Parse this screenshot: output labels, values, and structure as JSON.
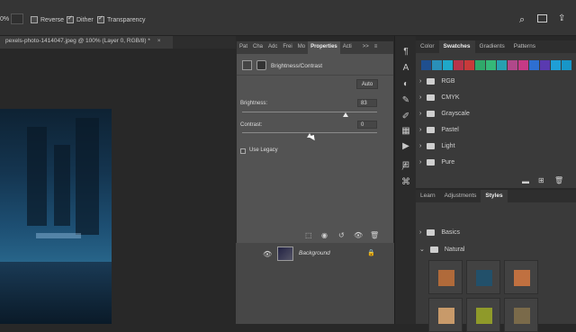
{
  "options_bar": {
    "zoom_value": "0%",
    "reverse_label": "Reverse",
    "reverse_checked": false,
    "dither_label": "Dither",
    "dither_checked": true,
    "transparency_label": "Transparency",
    "transparency_checked": true
  },
  "document": {
    "tab_title": "pexels-photo-1414047.jpeg @ 100% (Layer 0, RGB/8) *",
    "close_glyph": "×"
  },
  "properties_panel": {
    "tabs": [
      "Pat",
      "Cha",
      "Adc",
      "Frei",
      "Mo",
      "Properties",
      "Acti"
    ],
    "active_tab": "Properties",
    "collapse_glyph": ">>",
    "menu_glyph": "≡",
    "adjustment_title": "Brightness/Contrast",
    "auto_button": "Auto",
    "brightness_label": "Brightness:",
    "brightness_value": "83",
    "contrast_label": "Contrast:",
    "contrast_value": "0",
    "use_legacy_label": "Use Legacy",
    "use_legacy_checked": false
  },
  "layers": {
    "background_layer_name": "Background"
  },
  "swatches_panel": {
    "tabs": [
      "Color",
      "Swatches",
      "Gradients",
      "Patterns"
    ],
    "active_tab": "Swatches",
    "swatch_colors": [
      "#1f4f8f",
      "#2a8fb8",
      "#1fa8c8",
      "#b8344a",
      "#c93a3a",
      "#2fa86a",
      "#35b878",
      "#27a0b0",
      "#b0488a",
      "#c53a86",
      "#2e6fd1",
      "#5a3ab0",
      "#1f9fd6",
      "#1896c8"
    ],
    "folders": [
      "RGB",
      "CMYK",
      "Grayscale",
      "Pastel",
      "Light",
      "Pure"
    ]
  },
  "styles_panel": {
    "tabs": [
      "Learn",
      "Adjustments",
      "Styles"
    ],
    "active_tab": "Styles",
    "folders": [
      "Basics",
      "Natural"
    ],
    "tile_colors": [
      "#b06a3a",
      "#22506a",
      "#c07040",
      "#c89a6a",
      "#8f9a2a",
      "#7a6a4a"
    ]
  }
}
